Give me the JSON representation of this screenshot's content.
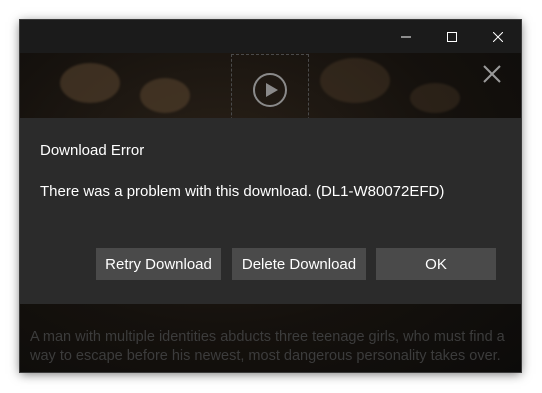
{
  "window": {
    "controls": {
      "minimize_icon": "minimize-icon",
      "maximize_icon": "maximize-icon",
      "close_icon": "close-icon"
    }
  },
  "background": {
    "description": "A man with multiple identities abducts three teenage girls, who must find a way to escape before his newest, most dangerous personality takes over.",
    "play_icon": "play-icon",
    "overlay_close_icon": "close-icon"
  },
  "dialog": {
    "title": "Download Error",
    "message": "There was a problem with this download. (DL1-W80072EFD)",
    "buttons": {
      "retry": "Retry Download",
      "delete": "Delete Download",
      "ok": "OK"
    }
  },
  "colors": {
    "dialog_bg": "#2b2b2b",
    "button_bg": "#4a4a4a",
    "window_bg": "#141414",
    "text": "#ffffff"
  }
}
